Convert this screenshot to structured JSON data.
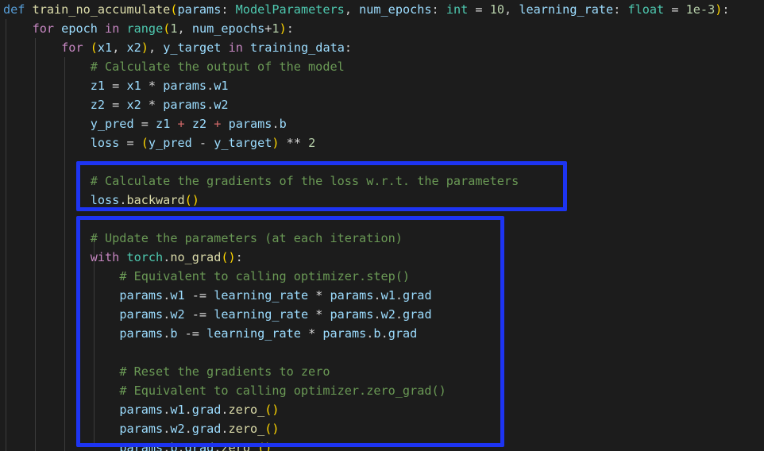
{
  "editor": {
    "language": "python",
    "background_color": "#1c1c1c",
    "font": "monospace",
    "line_height_px": 24
  },
  "theme_colors": {
    "keyword": "#569cd6",
    "control_keyword": "#c586c0",
    "function": "#dcdcaa",
    "variable": "#9cdcfe",
    "type": "#4ec9b0",
    "number": "#b5cea8",
    "comment": "#6a9955",
    "operator": "#d4d4d4",
    "bracket_level_1": "#ffd700",
    "bracket_level_2": "#da70d6",
    "highlight_box": "#1d34f2",
    "indent_guide": "#3b3b3b"
  },
  "annotations": [
    {
      "name": "backward-call-highlight",
      "shape": "rectangle",
      "color": "#1d34f2",
      "covers_lines": [
        "# Calculate the gradients of the loss w.r.t. the parameters",
        "loss.backward()"
      ]
    },
    {
      "name": "parameter-update-highlight",
      "shape": "rectangle",
      "color": "#1d34f2",
      "covers_lines": [
        "# Update the parameters (at each iteration)",
        "with torch.no_grad():",
        "# Equivalent to calling optimizer.step()",
        "params.w1 -= learning_rate * params.w1.grad",
        "params.w2 -= learning_rate * params.w2.grad",
        "params.b -= learning_rate * params.b.grad",
        "# Reset the gradients to zero",
        "# Equivalent to calling optimizer.zero_grad()",
        "params.w1.grad.zero_()",
        "params.w2.grad.zero_()",
        "params.b.grad.zero_()"
      ]
    }
  ],
  "code": {
    "function_name": "train_no_accumulate",
    "lines": [
      "def train_no_accumulate(params: ModelParameters, num_epochs: int = 10, learning_rate: float = 1e-3):",
      "    for epoch in range(1, num_epochs+1):",
      "        for (x1, x2), y_target in training_data:",
      "            # Calculate the output of the model",
      "            z1 = x1 * params.w1",
      "            z2 = x2 * params.w2",
      "            y_pred = z1 + z2 + params.b",
      "            loss = (y_pred - y_target) ** 2",
      "",
      "            # Calculate the gradients of the loss w.r.t. the parameters",
      "            loss.backward()",
      "",
      "            # Update the parameters (at each iteration)",
      "            with torch.no_grad():",
      "                # Equivalent to calling optimizer.step()",
      "                params.w1 -= learning_rate * params.w1.grad",
      "                params.w2 -= learning_rate * params.w2.grad",
      "                params.b -= learning_rate * params.b.grad",
      "",
      "                # Reset the gradients to zero",
      "                # Equivalent to calling optimizer.zero_grad()",
      "                params.w1.grad.zero_()",
      "                params.w2.grad.zero_()",
      "                params.b.grad.zero_()"
    ],
    "tokens": [
      [
        {
          "t": "def",
          "c": "kw"
        },
        {
          "t": " ",
          "c": "op"
        },
        {
          "t": "train_no_accumulate",
          "c": "fn"
        },
        {
          "t": "(",
          "c": "pn1"
        },
        {
          "t": "params",
          "c": "var"
        },
        {
          "t": ": ",
          "c": "pun"
        },
        {
          "t": "ModelParameters",
          "c": "typ"
        },
        {
          "t": ", ",
          "c": "pun"
        },
        {
          "t": "num_epochs",
          "c": "var"
        },
        {
          "t": ": ",
          "c": "pun"
        },
        {
          "t": "int",
          "c": "typ"
        },
        {
          "t": " = ",
          "c": "op"
        },
        {
          "t": "10",
          "c": "num"
        },
        {
          "t": ", ",
          "c": "pun"
        },
        {
          "t": "learning_rate",
          "c": "var"
        },
        {
          "t": ": ",
          "c": "pun"
        },
        {
          "t": "float",
          "c": "typ"
        },
        {
          "t": " = ",
          "c": "op"
        },
        {
          "t": "1e-3",
          "c": "num"
        },
        {
          "t": ")",
          "c": "pn1"
        },
        {
          "t": ":",
          "c": "pun"
        }
      ],
      [
        {
          "t": "    ",
          "c": "op"
        },
        {
          "t": "for",
          "c": "ctl"
        },
        {
          "t": " ",
          "c": "op"
        },
        {
          "t": "epoch",
          "c": "var"
        },
        {
          "t": " ",
          "c": "op"
        },
        {
          "t": "in",
          "c": "ctl"
        },
        {
          "t": " ",
          "c": "op"
        },
        {
          "t": "range",
          "c": "typ"
        },
        {
          "t": "(",
          "c": "pn1"
        },
        {
          "t": "1",
          "c": "num"
        },
        {
          "t": ", ",
          "c": "pun"
        },
        {
          "t": "num_epochs",
          "c": "var"
        },
        {
          "t": "+",
          "c": "op"
        },
        {
          "t": "1",
          "c": "num"
        },
        {
          "t": ")",
          "c": "pn1"
        },
        {
          "t": ":",
          "c": "pun"
        }
      ],
      [
        {
          "t": "        ",
          "c": "op"
        },
        {
          "t": "for",
          "c": "ctl"
        },
        {
          "t": " ",
          "c": "op"
        },
        {
          "t": "(",
          "c": "pn1"
        },
        {
          "t": "x1",
          "c": "var"
        },
        {
          "t": ", ",
          "c": "pun"
        },
        {
          "t": "x2",
          "c": "var"
        },
        {
          "t": ")",
          "c": "pn1"
        },
        {
          "t": ", ",
          "c": "pun"
        },
        {
          "t": "y_target",
          "c": "var"
        },
        {
          "t": " ",
          "c": "op"
        },
        {
          "t": "in",
          "c": "ctl"
        },
        {
          "t": " ",
          "c": "op"
        },
        {
          "t": "training_data",
          "c": "var"
        },
        {
          "t": ":",
          "c": "pun"
        }
      ],
      [
        {
          "t": "            ",
          "c": "op"
        },
        {
          "t": "# Calculate the output of the model",
          "c": "com"
        }
      ],
      [
        {
          "t": "            ",
          "c": "op"
        },
        {
          "t": "z1",
          "c": "var"
        },
        {
          "t": " = ",
          "c": "op"
        },
        {
          "t": "x1",
          "c": "var"
        },
        {
          "t": " * ",
          "c": "op"
        },
        {
          "t": "params",
          "c": "var"
        },
        {
          "t": ".",
          "c": "pun"
        },
        {
          "t": "w1",
          "c": "var"
        }
      ],
      [
        {
          "t": "            ",
          "c": "op"
        },
        {
          "t": "z2",
          "c": "var"
        },
        {
          "t": " = ",
          "c": "op"
        },
        {
          "t": "x2",
          "c": "var"
        },
        {
          "t": " * ",
          "c": "op"
        },
        {
          "t": "params",
          "c": "var"
        },
        {
          "t": ".",
          "c": "pun"
        },
        {
          "t": "w2",
          "c": "var"
        }
      ],
      [
        {
          "t": "            ",
          "c": "op"
        },
        {
          "t": "y_pred",
          "c": "var"
        },
        {
          "t": " = ",
          "c": "op"
        },
        {
          "t": "z1",
          "c": "var"
        },
        {
          "t": " ",
          "c": "op"
        },
        {
          "t": "+",
          "c": "opp"
        },
        {
          "t": " ",
          "c": "op"
        },
        {
          "t": "z2",
          "c": "var"
        },
        {
          "t": " ",
          "c": "op"
        },
        {
          "t": "+",
          "c": "opp"
        },
        {
          "t": " ",
          "c": "op"
        },
        {
          "t": "params",
          "c": "var"
        },
        {
          "t": ".",
          "c": "pun"
        },
        {
          "t": "b",
          "c": "var"
        }
      ],
      [
        {
          "t": "            ",
          "c": "op"
        },
        {
          "t": "loss",
          "c": "var"
        },
        {
          "t": " = ",
          "c": "op"
        },
        {
          "t": "(",
          "c": "pn1"
        },
        {
          "t": "y_pred",
          "c": "var"
        },
        {
          "t": " - ",
          "c": "op"
        },
        {
          "t": "y_target",
          "c": "var"
        },
        {
          "t": ")",
          "c": "pn1"
        },
        {
          "t": " ** ",
          "c": "op"
        },
        {
          "t": "2",
          "c": "num"
        }
      ],
      [],
      [
        {
          "t": "            ",
          "c": "op"
        },
        {
          "t": "# Calculate the gradients of the loss w.r.t. the parameters",
          "c": "com"
        }
      ],
      [
        {
          "t": "            ",
          "c": "op"
        },
        {
          "t": "loss",
          "c": "var"
        },
        {
          "t": ".",
          "c": "pun"
        },
        {
          "t": "backward",
          "c": "fn"
        },
        {
          "t": "()",
          "c": "pn1"
        }
      ],
      [],
      [
        {
          "t": "            ",
          "c": "op"
        },
        {
          "t": "# Update the parameters (at each iteration)",
          "c": "com"
        }
      ],
      [
        {
          "t": "            ",
          "c": "op"
        },
        {
          "t": "with",
          "c": "ctl"
        },
        {
          "t": " ",
          "c": "op"
        },
        {
          "t": "torch",
          "c": "typ"
        },
        {
          "t": ".",
          "c": "pun"
        },
        {
          "t": "no_grad",
          "c": "fn"
        },
        {
          "t": "()",
          "c": "pn1"
        },
        {
          "t": ":",
          "c": "pun"
        }
      ],
      [
        {
          "t": "                ",
          "c": "op"
        },
        {
          "t": "# Equivalent to calling optimizer.step()",
          "c": "com"
        }
      ],
      [
        {
          "t": "                ",
          "c": "op"
        },
        {
          "t": "params",
          "c": "var"
        },
        {
          "t": ".",
          "c": "pun"
        },
        {
          "t": "w1",
          "c": "var"
        },
        {
          "t": " -= ",
          "c": "op"
        },
        {
          "t": "learning_rate",
          "c": "var"
        },
        {
          "t": " * ",
          "c": "op"
        },
        {
          "t": "params",
          "c": "var"
        },
        {
          "t": ".",
          "c": "pun"
        },
        {
          "t": "w1",
          "c": "var"
        },
        {
          "t": ".",
          "c": "pun"
        },
        {
          "t": "grad",
          "c": "var"
        }
      ],
      [
        {
          "t": "                ",
          "c": "op"
        },
        {
          "t": "params",
          "c": "var"
        },
        {
          "t": ".",
          "c": "pun"
        },
        {
          "t": "w2",
          "c": "var"
        },
        {
          "t": " -= ",
          "c": "op"
        },
        {
          "t": "learning_rate",
          "c": "var"
        },
        {
          "t": " * ",
          "c": "op"
        },
        {
          "t": "params",
          "c": "var"
        },
        {
          "t": ".",
          "c": "pun"
        },
        {
          "t": "w2",
          "c": "var"
        },
        {
          "t": ".",
          "c": "pun"
        },
        {
          "t": "grad",
          "c": "var"
        }
      ],
      [
        {
          "t": "                ",
          "c": "op"
        },
        {
          "t": "params",
          "c": "var"
        },
        {
          "t": ".",
          "c": "pun"
        },
        {
          "t": "b",
          "c": "var"
        },
        {
          "t": " -= ",
          "c": "op"
        },
        {
          "t": "learning_rate",
          "c": "var"
        },
        {
          "t": " * ",
          "c": "op"
        },
        {
          "t": "params",
          "c": "var"
        },
        {
          "t": ".",
          "c": "pun"
        },
        {
          "t": "b",
          "c": "var"
        },
        {
          "t": ".",
          "c": "pun"
        },
        {
          "t": "grad",
          "c": "var"
        }
      ],
      [],
      [
        {
          "t": "                ",
          "c": "op"
        },
        {
          "t": "# Reset the gradients to zero",
          "c": "com"
        }
      ],
      [
        {
          "t": "                ",
          "c": "op"
        },
        {
          "t": "# Equivalent to calling optimizer.zero_grad()",
          "c": "com"
        }
      ],
      [
        {
          "t": "                ",
          "c": "op"
        },
        {
          "t": "params",
          "c": "var"
        },
        {
          "t": ".",
          "c": "pun"
        },
        {
          "t": "w1",
          "c": "var"
        },
        {
          "t": ".",
          "c": "pun"
        },
        {
          "t": "grad",
          "c": "var"
        },
        {
          "t": ".",
          "c": "pun"
        },
        {
          "t": "zero_",
          "c": "fn"
        },
        {
          "t": "()",
          "c": "pn1"
        }
      ],
      [
        {
          "t": "                ",
          "c": "op"
        },
        {
          "t": "params",
          "c": "var"
        },
        {
          "t": ".",
          "c": "pun"
        },
        {
          "t": "w2",
          "c": "var"
        },
        {
          "t": ".",
          "c": "pun"
        },
        {
          "t": "grad",
          "c": "var"
        },
        {
          "t": ".",
          "c": "pun"
        },
        {
          "t": "zero_",
          "c": "fn"
        },
        {
          "t": "()",
          "c": "pn1"
        }
      ],
      [
        {
          "t": "                ",
          "c": "op"
        },
        {
          "t": "params",
          "c": "var"
        },
        {
          "t": ".",
          "c": "pun"
        },
        {
          "t": "b",
          "c": "var"
        },
        {
          "t": ".",
          "c": "pun"
        },
        {
          "t": "grad",
          "c": "var"
        },
        {
          "t": ".",
          "c": "pun"
        },
        {
          "t": "zero_",
          "c": "fn"
        },
        {
          "t": "()",
          "c": "pn1"
        }
      ]
    ]
  }
}
